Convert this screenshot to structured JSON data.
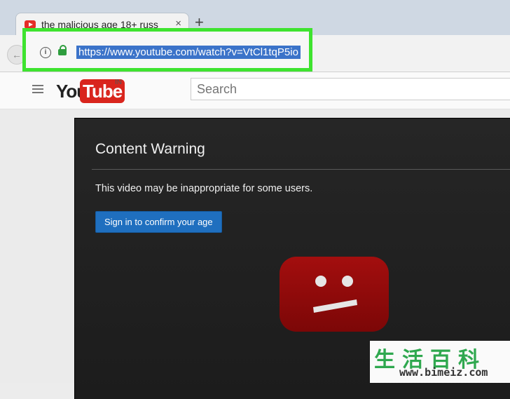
{
  "browser": {
    "tab_title": "the malicious age 18+ russ",
    "tab_close": "×",
    "new_tab": "+",
    "url": "https://www.youtube.com/watch?v=VtCl1tqP5io",
    "info_icon": "i",
    "back_icon": "arrow-left-icon",
    "lock_icon": "lock-icon"
  },
  "youtube": {
    "logo_you": "You",
    "logo_tube": "Tube",
    "logo_country": "IN",
    "search_placeholder": "Search"
  },
  "player": {
    "warning_title": "Content Warning",
    "warning_text": "This video may be inappropriate for some users.",
    "sign_in_button": "Sign in to confirm your age"
  },
  "watermark": {
    "chars": "生活百科",
    "url": "www.bimeiz.com"
  },
  "colors": {
    "highlight": "#3ee32f",
    "youtube_red": "#d9251d",
    "button_blue": "#1f6fbf",
    "sad_icon_red": "#9a0c0c"
  }
}
